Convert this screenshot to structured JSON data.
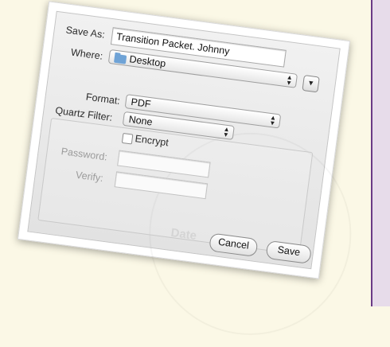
{
  "save_dialog": {
    "save_as_label": "Save As:",
    "save_as_value": "Transition Packet. Johnny",
    "where_label": "Where:",
    "where_value": "Desktop",
    "format_label": "Format:",
    "format_value": "PDF",
    "quartz_filter_label": "Quartz Filter:",
    "quartz_filter_value": "None",
    "encrypt_label": "Encrypt",
    "password_label": "Password:",
    "verify_label": "Verify:",
    "cancel_label": "Cancel",
    "save_label": "Save"
  },
  "background": {
    "ghost_text": "Date"
  },
  "icons": {
    "where_folder": "folder-icon",
    "expand": "chevron-down-icon",
    "popup_arrows": "up-down-arrows-icon"
  },
  "colors": {
    "page_background": "#fbf8e6",
    "side_panel": "#e7dcea",
    "divider": "#6a3a86",
    "folder": "#6fa3d6"
  }
}
